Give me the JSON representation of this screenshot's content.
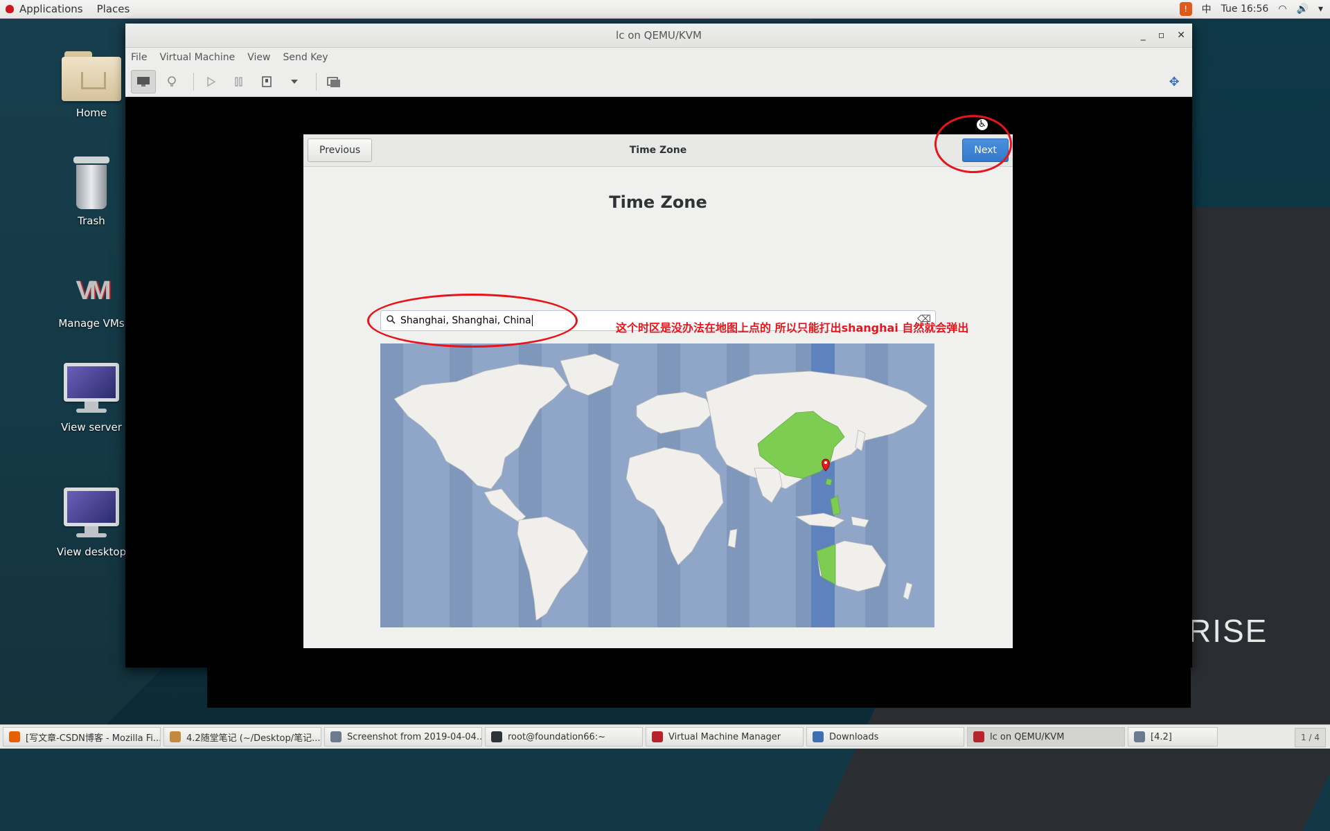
{
  "top_panel": {
    "applications": "Applications",
    "places": "Places",
    "input_method": "中",
    "clock": "Tue 16:56"
  },
  "desktop_icons": [
    {
      "label": "Home"
    },
    {
      "label": "Trash"
    },
    {
      "label": "Manage VMs"
    },
    {
      "label": "View server"
    },
    {
      "label": "View desktop"
    }
  ],
  "background_text": "RISE",
  "vm_window": {
    "title": "lc on QEMU/KVM",
    "controls": {
      "minimize": "_",
      "maximize": "▫",
      "close": "✕"
    },
    "menu": [
      "File",
      "Virtual Machine",
      "View",
      "Send Key"
    ]
  },
  "dialog": {
    "header_title": "Time Zone",
    "previous_label": "Previous",
    "next_label": "Next",
    "page_title": "Time Zone",
    "search_value": "Shanghai, Shanghai, China"
  },
  "annotation": {
    "text": "这个时区是没办法在地图上点的 所以只能打出shanghai 自然就会弹出",
    "color": "#e8141b"
  },
  "taskbar": {
    "tasks": [
      {
        "label": "[写文章-CSDN博客 - Mozilla Fi...",
        "icon_color": "#e66000"
      },
      {
        "label": "4.2随堂笔记 (~/Desktop/笔记...",
        "icon_color": "#c28a3e"
      },
      {
        "label": "Screenshot from 2019-04-04...",
        "icon_color": "#6b7a8f"
      },
      {
        "label": "root@foundation66:~",
        "icon_color": "#2e3436"
      },
      {
        "label": "Virtual Machine Manager",
        "icon_color": "#b6232a"
      },
      {
        "label": "Downloads",
        "icon_color": "#3e6fb0"
      },
      {
        "label": "lc on QEMU/KVM",
        "icon_color": "#b6232a"
      },
      {
        "label": "[4.2]",
        "icon_color": "#6b7a8f"
      }
    ],
    "pager": "1 / 4"
  },
  "colors": {
    "accent_next": "#3379cc",
    "china_highlight": "#7ccd52",
    "map_ocean": "#8fa6c8"
  }
}
